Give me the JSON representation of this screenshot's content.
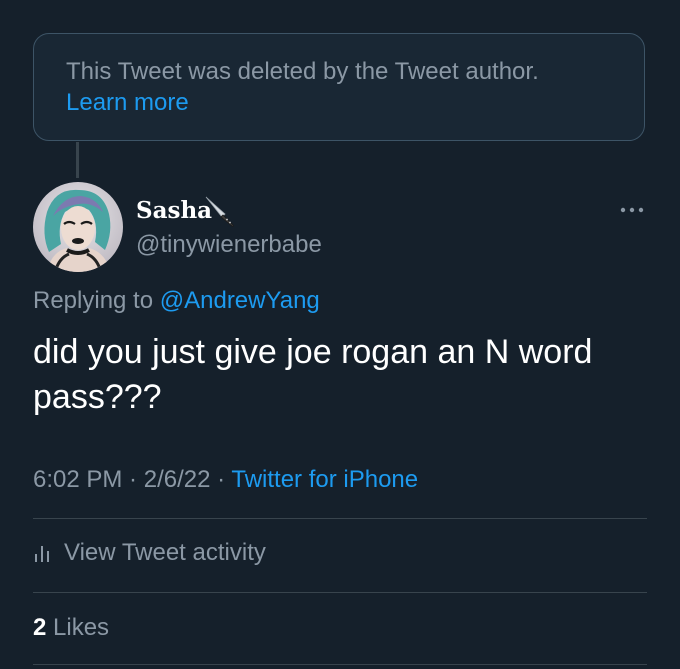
{
  "deleted_notice": {
    "text": "This Tweet was deleted by the Tweet author.",
    "link": "Learn more"
  },
  "author": {
    "name": "Sasha",
    "emoji_icon": "knife-icon",
    "handle": "@tinywienerbabe"
  },
  "reply": {
    "prefix": "Replying to ",
    "to_handle": "@AndrewYang"
  },
  "tweet": {
    "text": "did you just give joe rogan an N word pass???"
  },
  "meta": {
    "time": "6:02 PM",
    "sep1": " · ",
    "date": "2/6/22",
    "sep2": " · ",
    "source": "Twitter for iPhone"
  },
  "activity": {
    "icon": "bar-chart-icon",
    "label": "View Tweet activity"
  },
  "likes": {
    "count": "2",
    "label": " Likes"
  },
  "colors": {
    "background": "#15202b",
    "card_background": "#192734",
    "border": "#38444d",
    "text_primary": "#ffffff",
    "text_secondary": "#8b98a5",
    "link": "#1d9bf0"
  }
}
